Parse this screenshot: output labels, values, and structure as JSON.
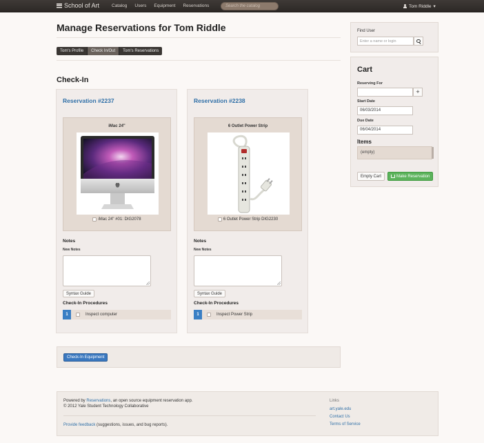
{
  "navbar": {
    "brand": "School of Art",
    "links": [
      "Catalog",
      "Users",
      "Equipment",
      "Reservations"
    ],
    "search_placeholder": "Search the catalog",
    "user": "Tom Riddle",
    "caret": "▾"
  },
  "page": {
    "title": "Manage Reservations for Tom Riddle",
    "tabs": [
      "Tom's Profile",
      "Check In/Out",
      "Tom's Reservations"
    ],
    "active_tab": 1,
    "section_title": "Check-In"
  },
  "reservations": [
    {
      "link": "Reservation #2237",
      "item_title": "iMac 24\"",
      "item_label": "iMac 24\" #01: DIG2078",
      "image_icon": "imac-icon",
      "notes_label": "Notes",
      "new_notes_label": "New Notes",
      "syntax_label": "Syntax Guide",
      "procedures_label": "Check-In Procedures",
      "procedures": [
        {
          "num": "1",
          "text": "Inspect computer"
        }
      ]
    },
    {
      "link": "Reservation #2238",
      "item_title": "6 Outlet Power Strip",
      "item_label": "6 Outlet Power Strip DIG2230",
      "image_icon": "power-strip-icon",
      "notes_label": "Notes",
      "new_notes_label": "New Notes",
      "syntax_label": "Syntax Guide",
      "procedures_label": "Check-In Procedures",
      "procedures": [
        {
          "num": "1",
          "text": "Inspect Power Strip"
        }
      ]
    }
  ],
  "checkin_button": "Check-In Equipment",
  "sidebar": {
    "find_user": {
      "label": "Find User",
      "placeholder": "Enter a name or login"
    },
    "cart": {
      "title": "Cart",
      "reserving_for_label": "Reserving For",
      "reserving_for_value": "",
      "start_date_label": "Start Date",
      "start_date": "06/03/2014",
      "due_date_label": "Due Date",
      "due_date": "06/04/2014",
      "items_label": "Items",
      "items_empty": "(empty)",
      "empty_cart": "Empty Cart",
      "make_reservation": "Make Reservation"
    }
  },
  "footer": {
    "powered_prefix": "Powered by ",
    "powered_link": "Reservations",
    "powered_suffix": ", an open source equipment reservation app.",
    "copyright": "© 2012 Yale Student Technology Collaborative",
    "feedback_link": "Provide feedback",
    "feedback_suffix": " (suggestions, issues, and bug reports).",
    "links_title": "Links",
    "links": [
      "art.yale.edu",
      "Contact Us",
      "Terms of Service"
    ]
  },
  "colors": {
    "navbar": "#2c2826",
    "link": "#2f6fa7",
    "primary_button": "#3a78bf",
    "success_button": "#5cb35c",
    "procedure_badge": "#3a7fc4"
  }
}
